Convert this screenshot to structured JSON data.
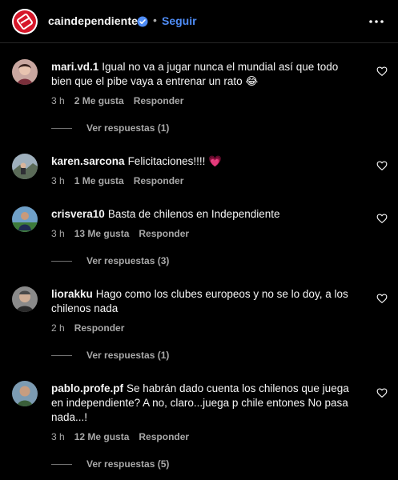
{
  "header": {
    "username": "caindependiente",
    "separator": "•",
    "follow_label": "Seguir"
  },
  "comments": [
    {
      "user": "mari.vd.1",
      "text": "Igual no va a jugar nunca el mundial así que todo bien que el pibe vaya a entrenar un rato 😂",
      "time": "3 h",
      "likes": "2 Me gusta",
      "reply_label": "Responder",
      "view_replies": "Ver respuestas (1)"
    },
    {
      "user": "karen.sarcona",
      "text": "Felicitaciones!!!! 💗",
      "time": "3 h",
      "likes": "1 Me gusta",
      "reply_label": "Responder"
    },
    {
      "user": "crisvera10",
      "text": "Basta de chilenos en Independiente",
      "time": "3 h",
      "likes": "13 Me gusta",
      "reply_label": "Responder",
      "view_replies": "Ver respuestas (3)"
    },
    {
      "user": "liorakku",
      "text": "Hago como los clubes europeos y no se lo doy, a los chilenos nada",
      "time": "2 h",
      "reply_label": "Responder",
      "view_replies": "Ver respuestas (1)"
    },
    {
      "user": "pablo.profe.pf",
      "text": "Se habrán dado cuenta los chilenos que juega en independiente? A no, claro...juega p chile entones No pasa nada...!",
      "time": "3 h",
      "likes": "12 Me gusta",
      "reply_label": "Responder",
      "view_replies": "Ver respuestas (5)"
    }
  ],
  "colors": {
    "background": "#000000",
    "text": "#f5f5f5",
    "muted": "#a8a8a8",
    "link": "#4f8df7",
    "brand": "#d6172a"
  },
  "icons": [
    "brand-logo-icon",
    "verified-badge-icon",
    "more-options-icon",
    "heart-icon"
  ]
}
